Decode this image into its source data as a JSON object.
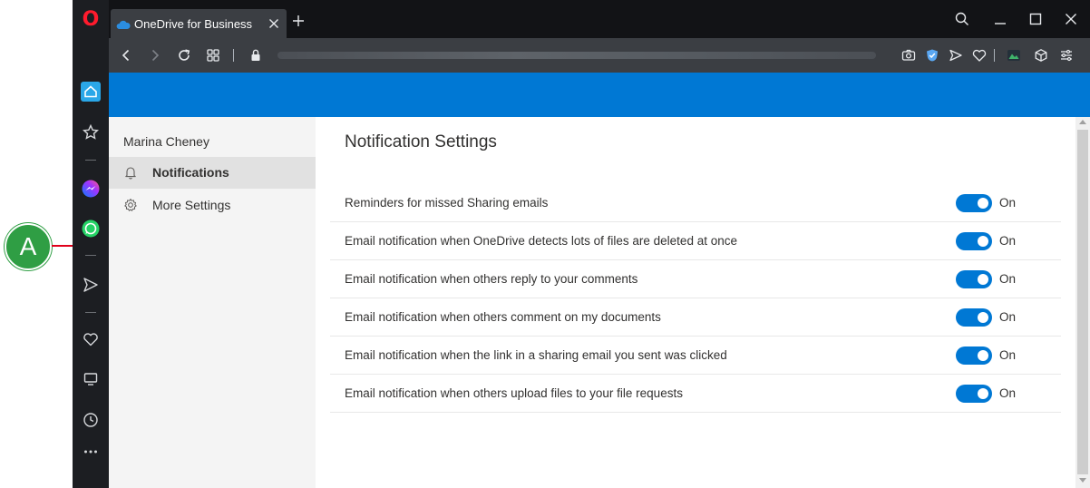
{
  "browser": {
    "tab_title": "OneDrive for Business",
    "colors": {
      "accent": "#0078d4",
      "opera_red": "#ff1b2d"
    }
  },
  "settings_nav": {
    "user_name": "Marina Cheney",
    "items": [
      {
        "label": "Notifications",
        "icon": "bell-icon",
        "selected": true
      },
      {
        "label": "More Settings",
        "icon": "gear-icon",
        "selected": false
      }
    ]
  },
  "main": {
    "title": "Notification Settings",
    "settings": [
      {
        "label": "Reminders for missed Sharing emails",
        "state": "On"
      },
      {
        "label": "Email notification when OneDrive detects lots of files are deleted at once",
        "state": "On"
      },
      {
        "label": "Email notification when others reply to your comments",
        "state": "On"
      },
      {
        "label": "Email notification when others comment on my documents",
        "state": "On"
      },
      {
        "label": "Email notification when the link in a sharing email you sent was clicked",
        "state": "On"
      },
      {
        "label": "Email notification when others upload files to your file requests",
        "state": "On"
      }
    ]
  },
  "callout": {
    "label": "A"
  }
}
